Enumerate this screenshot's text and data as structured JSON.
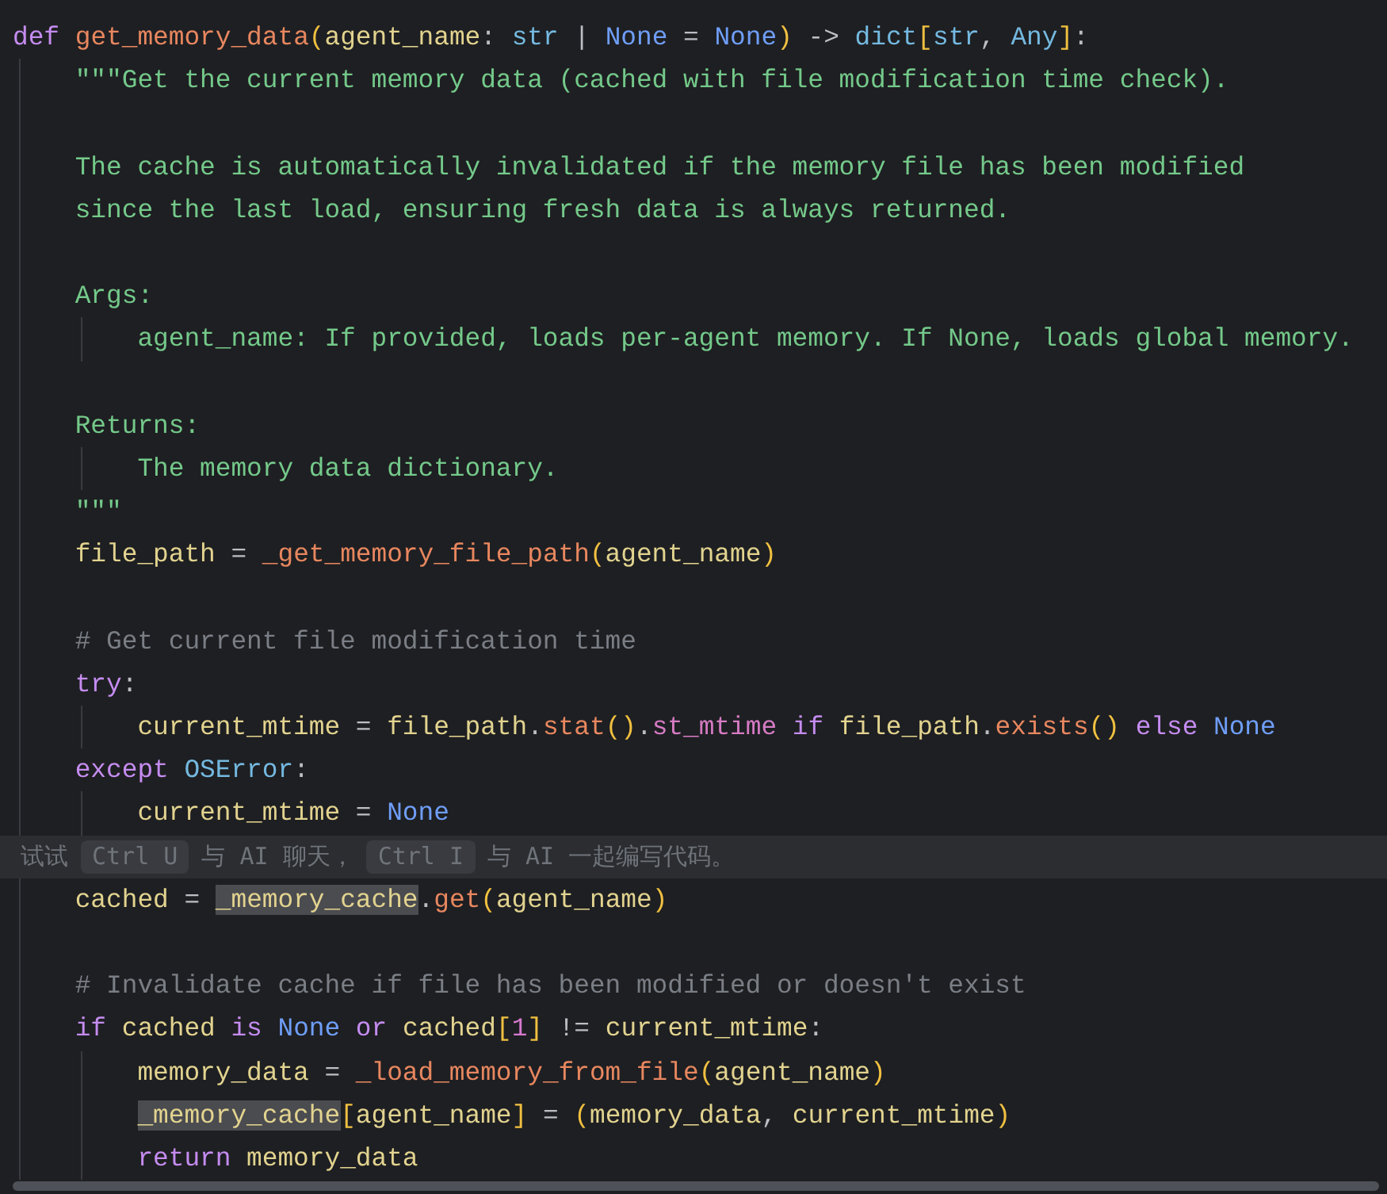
{
  "editor": {
    "lines": [
      {
        "tokens": [
          {
            "text": "def ",
            "kind": "kw"
          },
          {
            "text": "get_memory_data",
            "kind": "fn"
          },
          {
            "text": "(",
            "kind": "paren"
          },
          {
            "text": "agent_name",
            "kind": "var"
          },
          {
            "text": ": ",
            "kind": "op"
          },
          {
            "text": "str",
            "kind": "type"
          },
          {
            "text": " | ",
            "kind": "op"
          },
          {
            "text": "None",
            "kind": "const"
          },
          {
            "text": " = ",
            "kind": "op"
          },
          {
            "text": "None",
            "kind": "const"
          },
          {
            "text": ")",
            "kind": "paren"
          },
          {
            "text": " -> ",
            "kind": "op"
          },
          {
            "text": "dict",
            "kind": "type"
          },
          {
            "text": "[",
            "kind": "paren"
          },
          {
            "text": "str",
            "kind": "type"
          },
          {
            "text": ", ",
            "kind": "op"
          },
          {
            "text": "Any",
            "kind": "type"
          },
          {
            "text": "]",
            "kind": "paren"
          },
          {
            "text": ":",
            "kind": "op"
          }
        ],
        "children": [
          {
            "tokens": [
              {
                "text": "\"\"\"Get the current memory data (cached with file modification time check).",
                "kind": "doc"
              }
            ]
          },
          {
            "kind": "blank"
          },
          {
            "tokens": [
              {
                "text": "The cache is automatically invalidated if the memory file has been modified",
                "kind": "doc"
              }
            ]
          },
          {
            "tokens": [
              {
                "text": "since the last load, ensuring fresh data is always returned.",
                "kind": "doc"
              }
            ]
          },
          {
            "kind": "blank"
          },
          {
            "tokens": [
              {
                "text": "Args:",
                "kind": "doc"
              }
            ],
            "children": [
              {
                "tokens": [
                  {
                    "text": "agent_name: If provided, loads per-agent memory. If None, loads global memory.",
                    "kind": "doc"
                  }
                ]
              }
            ]
          },
          {
            "kind": "blank"
          },
          {
            "tokens": [
              {
                "text": "Returns:",
                "kind": "doc"
              }
            ],
            "children": [
              {
                "tokens": [
                  {
                    "text": "The memory data dictionary.",
                    "kind": "doc"
                  }
                ]
              }
            ]
          },
          {
            "tokens": [
              {
                "text": "\"\"\"",
                "kind": "doc"
              }
            ]
          },
          {
            "tokens": [
              {
                "text": "file_path",
                "kind": "var"
              },
              {
                "text": " = ",
                "kind": "op"
              },
              {
                "text": "_get_memory_file_path",
                "kind": "fn"
              },
              {
                "text": "(",
                "kind": "paren"
              },
              {
                "text": "agent_name",
                "kind": "var"
              },
              {
                "text": ")",
                "kind": "paren"
              }
            ]
          },
          {
            "kind": "blank"
          },
          {
            "tokens": [
              {
                "text": "# Get current file modification time",
                "kind": "comment"
              }
            ]
          },
          {
            "tokens": [
              {
                "text": "try",
                "kind": "kw"
              },
              {
                "text": ":",
                "kind": "op"
              }
            ],
            "children": [
              {
                "tokens": [
                  {
                    "text": "current_mtime",
                    "kind": "var"
                  },
                  {
                    "text": " = ",
                    "kind": "op"
                  },
                  {
                    "text": "file_path",
                    "kind": "var"
                  },
                  {
                    "text": ".",
                    "kind": "op"
                  },
                  {
                    "text": "stat",
                    "kind": "fn"
                  },
                  {
                    "text": "()",
                    "kind": "paren"
                  },
                  {
                    "text": ".",
                    "kind": "op"
                  },
                  {
                    "text": "st_mtime ",
                    "kind": "attr"
                  },
                  {
                    "text": "if ",
                    "kind": "kw"
                  },
                  {
                    "text": "file_path",
                    "kind": "var"
                  },
                  {
                    "text": ".",
                    "kind": "op"
                  },
                  {
                    "text": "exists",
                    "kind": "fn"
                  },
                  {
                    "text": "() ",
                    "kind": "paren"
                  },
                  {
                    "text": "else ",
                    "kind": "kw"
                  },
                  {
                    "text": "None",
                    "kind": "const"
                  }
                ]
              }
            ]
          },
          {
            "tokens": [
              {
                "text": "except ",
                "kind": "kw"
              },
              {
                "text": "OSError",
                "kind": "type"
              },
              {
                "text": ":",
                "kind": "op"
              }
            ],
            "children": [
              {
                "tokens": [
                  {
                    "text": "current_mtime",
                    "kind": "var"
                  },
                  {
                    "text": " = ",
                    "kind": "op"
                  },
                  {
                    "text": "None",
                    "kind": "const"
                  }
                ]
              }
            ]
          },
          {
            "kind": "hint",
            "segments": [
              {
                "text": "试试",
                "kind": "text"
              },
              {
                "text": "Ctrl U",
                "kind": "key"
              },
              {
                "text": "与 AI 聊天，",
                "kind": "text"
              },
              {
                "text": "Ctrl I",
                "kind": "key"
              },
              {
                "text": "与 AI 一起编写代码。",
                "kind": "text"
              }
            ]
          },
          {
            "tokens": [
              {
                "text": "cached",
                "kind": "var"
              },
              {
                "text": " = ",
                "kind": "op"
              },
              {
                "text": "_memory_cache",
                "kind": "var",
                "highlighted": true
              },
              {
                "text": ".",
                "kind": "op"
              },
              {
                "text": "get",
                "kind": "fn"
              },
              {
                "text": "(",
                "kind": "paren"
              },
              {
                "text": "agent_name",
                "kind": "var"
              },
              {
                "text": ")",
                "kind": "paren"
              }
            ]
          },
          {
            "kind": "blank"
          },
          {
            "tokens": [
              {
                "text": "# Invalidate cache if file has been modified or doesn't exist",
                "kind": "comment"
              }
            ]
          },
          {
            "tokens": [
              {
                "text": "if ",
                "kind": "kw"
              },
              {
                "text": "cached ",
                "kind": "var"
              },
              {
                "text": "is ",
                "kind": "kw"
              },
              {
                "text": "None ",
                "kind": "const"
              },
              {
                "text": "or ",
                "kind": "kw"
              },
              {
                "text": "cached",
                "kind": "var"
              },
              {
                "text": "[",
                "kind": "paren"
              },
              {
                "text": "1",
                "kind": "num"
              },
              {
                "text": "]",
                "kind": "paren"
              },
              {
                "text": " != ",
                "kind": "op"
              },
              {
                "text": "current_mtime",
                "kind": "var"
              },
              {
                "text": ":",
                "kind": "op"
              }
            ],
            "children": [
              {
                "tokens": [
                  {
                    "text": "memory_data",
                    "kind": "var"
                  },
                  {
                    "text": " = ",
                    "kind": "op"
                  },
                  {
                    "text": "_load_memory_from_file",
                    "kind": "fn"
                  },
                  {
                    "text": "(",
                    "kind": "paren"
                  },
                  {
                    "text": "agent_name",
                    "kind": "var"
                  },
                  {
                    "text": ")",
                    "kind": "paren"
                  }
                ]
              },
              {
                "tokens": [
                  {
                    "text": "_memory_cache",
                    "kind": "var",
                    "highlighted": true
                  },
                  {
                    "text": "[",
                    "kind": "paren"
                  },
                  {
                    "text": "agent_name",
                    "kind": "var"
                  },
                  {
                    "text": "]",
                    "kind": "paren"
                  },
                  {
                    "text": " = ",
                    "kind": "op"
                  },
                  {
                    "text": "(",
                    "kind": "paren"
                  },
                  {
                    "text": "memory_data",
                    "kind": "var"
                  },
                  {
                    "text": ", ",
                    "kind": "op"
                  },
                  {
                    "text": "current_mtime",
                    "kind": "var"
                  },
                  {
                    "text": ")",
                    "kind": "paren"
                  }
                ]
              },
              {
                "tokens": [
                  {
                    "text": "return ",
                    "kind": "kw"
                  },
                  {
                    "text": "memory_data",
                    "kind": "var"
                  }
                ]
              }
            ]
          }
        ]
      }
    ]
  }
}
